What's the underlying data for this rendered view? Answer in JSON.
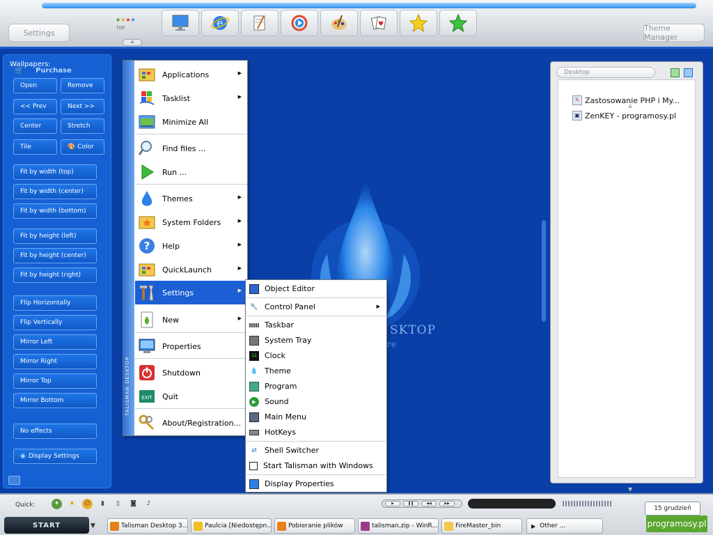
{
  "topbar": {
    "settings_label": "Settings",
    "theme_manager_label": "Theme Manager",
    "top_label": "TOP",
    "add_label": "+",
    "quick_icons": [
      "monitor-icon",
      "ie-icon",
      "notepad-icon",
      "media-player-icon",
      "paint-palette-icon",
      "cards-icon",
      "yellow-star-icon",
      "green-star-icon"
    ]
  },
  "left_panel": {
    "title": "Wallpapers:",
    "purchase": "Purchase",
    "buttons": {
      "open": "Open",
      "remove": "Remove",
      "prev": "<< Prev",
      "next": "Next >>",
      "center": "Center",
      "stretch": "Stretch",
      "tile": "Tile",
      "color": "Color",
      "fit_width_top": "Fit by width (top)",
      "fit_width_center": "Fit by width (center)",
      "fit_width_bottom": "Fit by width (bottom)",
      "fit_height_left": "Fit by height (left)",
      "fit_height_center": "Fit by height (center)",
      "fit_height_right": "Fit by height (right)",
      "flip_h": "Flip Horizontally",
      "flip_v": "Flip Vertically",
      "mirror_left": "Mirror Left",
      "mirror_right": "Mirror Right",
      "mirror_top": "Mirror Top",
      "mirror_bottom": "Mirror Bottom",
      "no_effects": "No effects",
      "display_settings": "Display Settings"
    }
  },
  "right_panel": {
    "field": "Desktop",
    "items": [
      "Zastosowanie PHP i My...",
      "ZenKEY - programosy.pl"
    ]
  },
  "desktop": {
    "brand": "SKTOP",
    "brand_sub": "re"
  },
  "start_menu": {
    "side_label": "TALISMAN DESKTOP",
    "items": {
      "applications": "Applications",
      "tasklist": "Tasklist",
      "minimize_all": "Minimize All",
      "find_files": "Find files ...",
      "run": "Run ...",
      "themes": "Themes",
      "system_folders": "System Folders",
      "help": "Help",
      "quicklaunch": "QuickLaunch",
      "settings": "Settings",
      "new": "New",
      "properties": "Properties",
      "shutdown": "Shutdown",
      "quit": "Quit",
      "about": "About/Registration..."
    }
  },
  "settings_submenu": {
    "object_editor": "Object Editor",
    "control_panel": "Control Panel",
    "taskbar": "Taskbar",
    "system_tray": "System Tray",
    "clock": "Clock",
    "theme": "Theme",
    "program": "Program",
    "sound": "Sound",
    "main_menu": "Main Menu",
    "hotkeys": "HotKeys",
    "shell_switcher": "Shell Switcher",
    "start_with_windows": "Start Talisman with Windows",
    "display_properties": "Display Properties"
  },
  "bottombar": {
    "quick_label": "Quick:",
    "start_label": "START",
    "date": "15 grudzień",
    "watermark": "programosy.pl",
    "tasks": {
      "t1": "Talisman Desktop 3....",
      "t2": "Paulcia [Niedostępn...",
      "t3": "Pobieranie plików",
      "t4": "talisman.zip - WinR...",
      "t5": "FireMaster_bin",
      "t6": "Other ..."
    }
  },
  "colors": {
    "desktop_bg": "#0a3fa8",
    "menu_highlight": "#1c5fd4",
    "panel_blue": "#1560d3"
  }
}
